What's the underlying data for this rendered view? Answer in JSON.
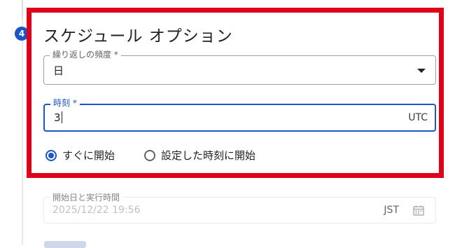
{
  "step": {
    "number": "4"
  },
  "section": {
    "title": "スケジュール オプション"
  },
  "repeat_field": {
    "label": "繰り返しの頻度 *",
    "value": "日"
  },
  "time_field": {
    "label": "時刻 *",
    "value": "3",
    "suffix": "UTC"
  },
  "radio_options": [
    {
      "label": "すぐに開始",
      "checked": true
    },
    {
      "label": "設定した時刻に開始",
      "checked": false
    }
  ],
  "start_field": {
    "label": "開始日と実行時間",
    "value": "2025/12/22 19:56",
    "suffix": "JST",
    "icon": "calendar-icon"
  },
  "colors": {
    "accent": "#1a56c8",
    "highlight": "#e0001a"
  }
}
